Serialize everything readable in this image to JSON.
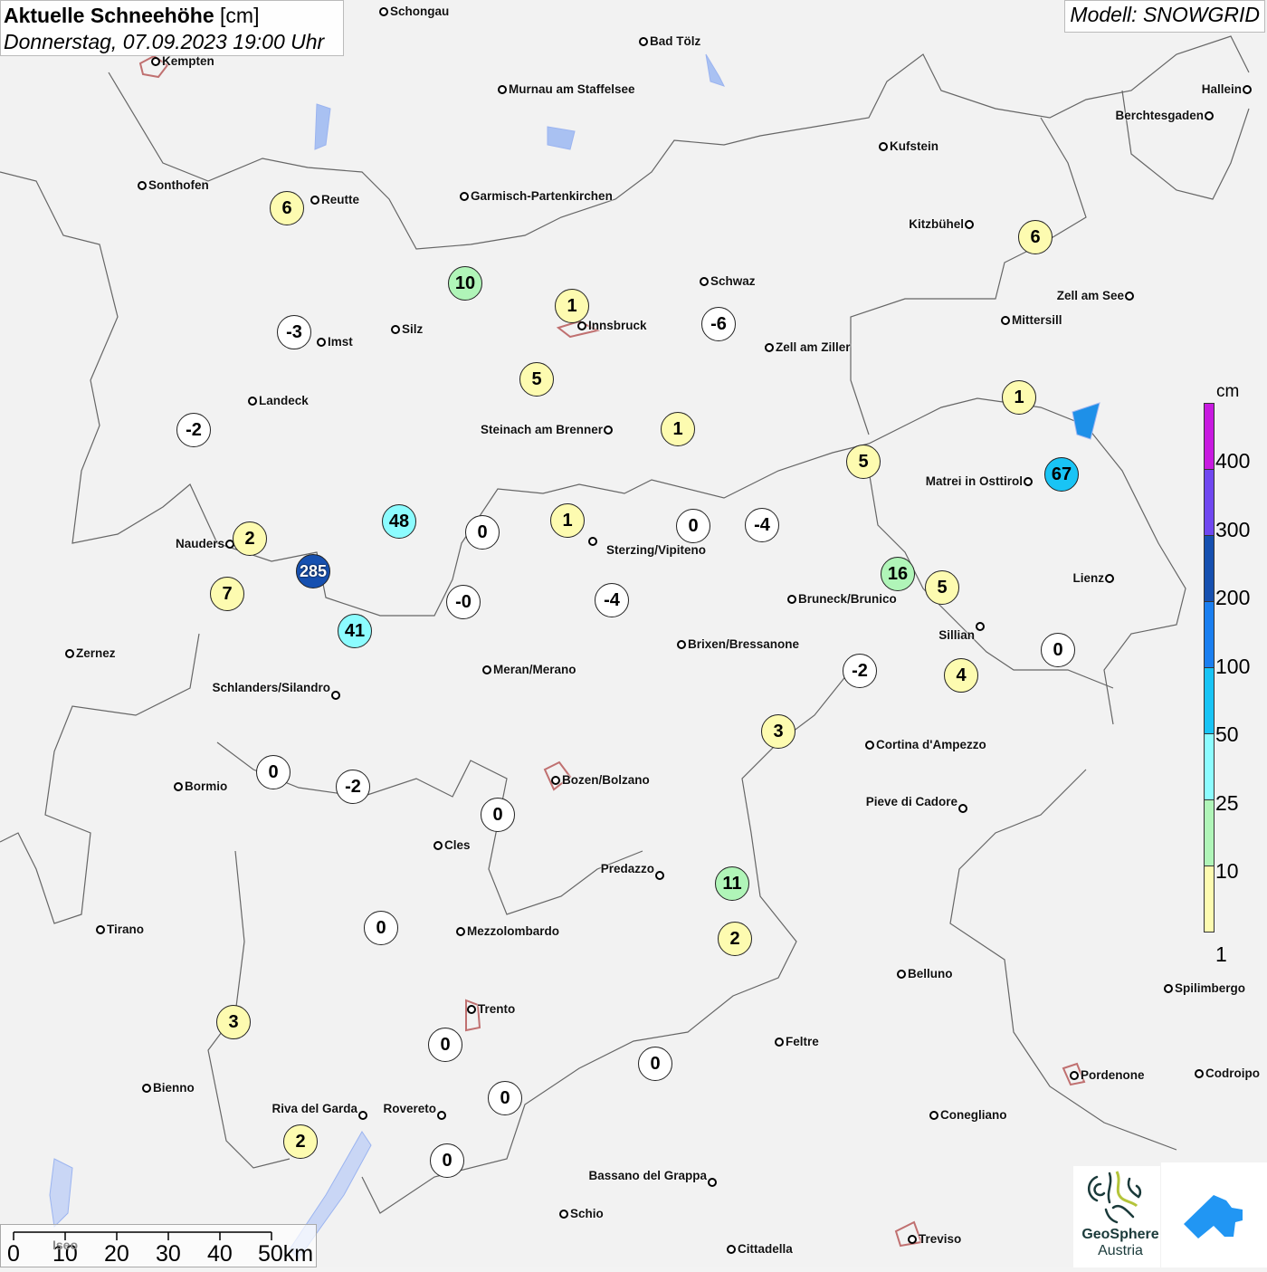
{
  "header": {
    "title": "Aktuelle Schneehöhe",
    "title_unit": "[cm]",
    "subtitle": "Donnerstag, 07.09.2023 19:00 Uhr",
    "model": "Modell: SNOWGRID"
  },
  "legend": {
    "unit": "cm",
    "labels": [
      "400",
      "300",
      "200",
      "100",
      "50",
      "25",
      "10",
      "1"
    ],
    "colors": [
      "#c81ae0",
      "#7048f0",
      "#1650b0",
      "#1b7ff0",
      "#19c4f5",
      "#8cfcff",
      "#b0f5b8",
      "#fdfbb0"
    ]
  },
  "scale_bar": {
    "labels": [
      "0",
      "10",
      "20",
      "30",
      "40",
      "50km"
    ]
  },
  "cities": [
    "Schongau",
    "Bad Tölz",
    "Kempten",
    "Murnau am Staffelsee",
    "Hallein",
    "Berchtesgaden",
    "Kufstein",
    "Sonthofen",
    "Reutte",
    "Garmisch-Partenkirchen",
    "Kitzbühel",
    "Schwaz",
    "Zell am See",
    "Mittersill",
    "Innsbruck",
    "Silz",
    "Imst",
    "Zell am Ziller",
    "Landeck",
    "Steinach am Brenner",
    "Matrei in Osttirol",
    "Nauders",
    "Sterzing/Vipiteno",
    "Lienz",
    "Bruneck/Brunico",
    "Sillian",
    "Zernez",
    "Brixen/Bressanone",
    "Meran/Merano",
    "Schlanders/Silandro",
    "Cortina d'Ampezzo",
    "Bozen/Bolzano",
    "Bormio",
    "Pieve di Cadore",
    "Cles",
    "Predazzo",
    "Tirano",
    "Mezzolombardo",
    "Belluno",
    "Spilimbergo",
    "Trento",
    "Feltre",
    "Pordenone",
    "Codroipo",
    "Bienno",
    "Riva del Garda",
    "Rovereto",
    "Conegliano",
    "Bassano del Grappa",
    "Schio",
    "Treviso",
    "Cittadella"
  ],
  "faint_label": "Iseo",
  "snow_values": [
    "6",
    "10",
    "1",
    "-3",
    "-6",
    "5",
    "-2",
    "1",
    "6",
    "1",
    "5",
    "67",
    "48",
    "0",
    "1",
    "0",
    "-4",
    "2",
    "285",
    "7",
    "41",
    "-0",
    "-4",
    "16",
    "5",
    "0",
    "-2",
    "4",
    "3",
    "0",
    "-2",
    "0",
    "11",
    "2",
    "0",
    "3",
    "0",
    "0",
    "0",
    "2",
    "0"
  ],
  "logos": {
    "geosphere": "GeoSphere",
    "geosphere_sub": "Austria"
  }
}
